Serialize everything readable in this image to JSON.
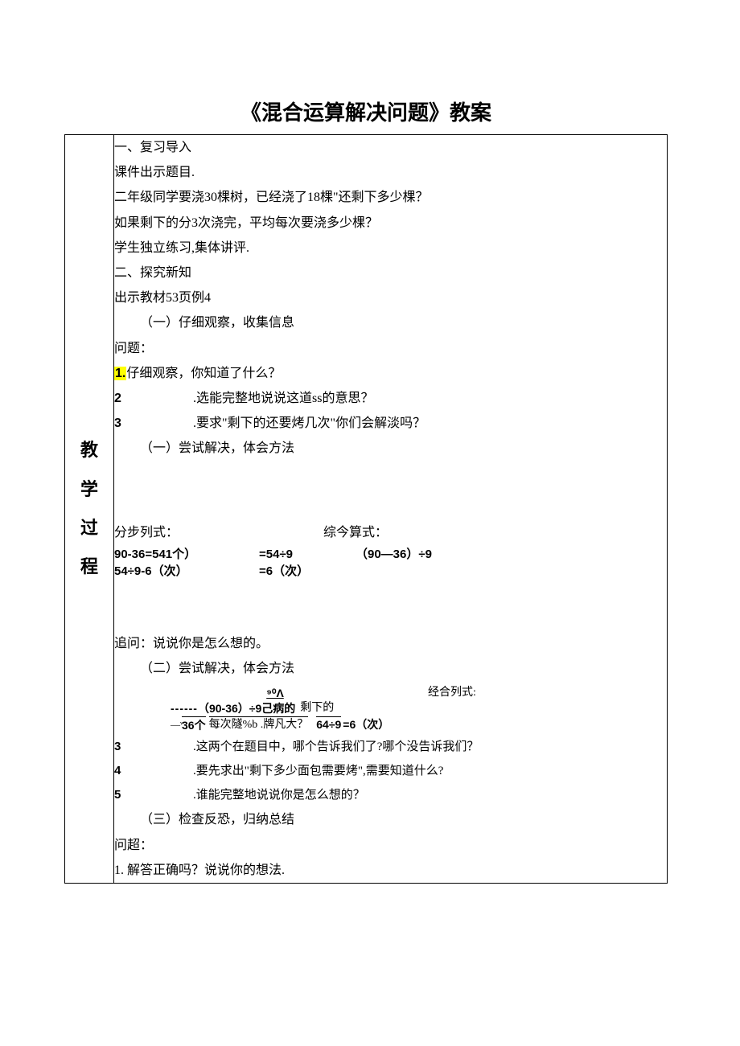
{
  "title": "《混合运算解决问题》教案",
  "sideLabel": "教\n学\n过\n程",
  "s1_heading": "一、复习导入",
  "s1_l1": "课件出示题目.",
  "s1_l2": "二年级同学要浇30棵树，已经浇了18棵\"还剩下多少棵？",
  "s1_l3": "如果剩下的分3次浇完，平均每次要浇多少棵？",
  "s1_l4": "学生独立练习,集体讲评.",
  "s2_heading": "二、探究新知",
  "s2_l1": "出示教材53页例4",
  "s2_sub1": "（一）仔细观察，收集信息",
  "s2_q": "问题：",
  "q1_num": "1.",
  "q1_text": "仔细观察，你知道了什么？",
  "q2_num": "2",
  "q2_text": ".选能完整地说说这道ss的意思？",
  "q3_num": "3",
  "q3_text": ".要求\"剩下的还要烤几次\"你们会解淡吗？",
  "s2_sub2": "（一）尝试解决，体会方法",
  "calc_label_left": "分步列式：",
  "calc_label_right": "综今算式：",
  "calc_l1_a": "90-36=541个）",
  "calc_l1_b": "=54÷9",
  "calc_l1_c": "（90—36）÷9",
  "calc_l2_a": "54÷9-6（次）",
  "calc_l2_b": "=6（次）",
  "follow": "追问：说说你是怎么想的。",
  "s2_sub3": "（二）尝试解决，体会方法",
  "dia_top": "⁹⁰Λ",
  "dia_combo": "经合列式:",
  "dia_mid_dash": "------",
  "dia_mid_expr": "（90-36）÷9己病的",
  "dia_mid_right": "剩下的",
  "dia_sub_left": "—ᵛ",
  "dia_bot_a": "36个",
  "dia_bot_b": "每次隧%b .牌凡大？",
  "dia_bot_eq1": "64÷9",
  "dia_bot_eq2": "=6（次）",
  "q4_num": "3",
  "q4_text": ".这两个在题目中，哪个告诉我们了?哪个没告诉我们？",
  "q5_num": "4",
  "q5_text": ".要先求出\"剩下多少面包需要烤\",需要知道什么?",
  "q6_num": "5",
  "q6_text": ".谁能完整地说说你是怎么想的？",
  "s2_sub4": "（三）检查反恐，归纳总结",
  "s2_q2": "问超：",
  "q7": "1. 解答正确吗？说说你的想法."
}
